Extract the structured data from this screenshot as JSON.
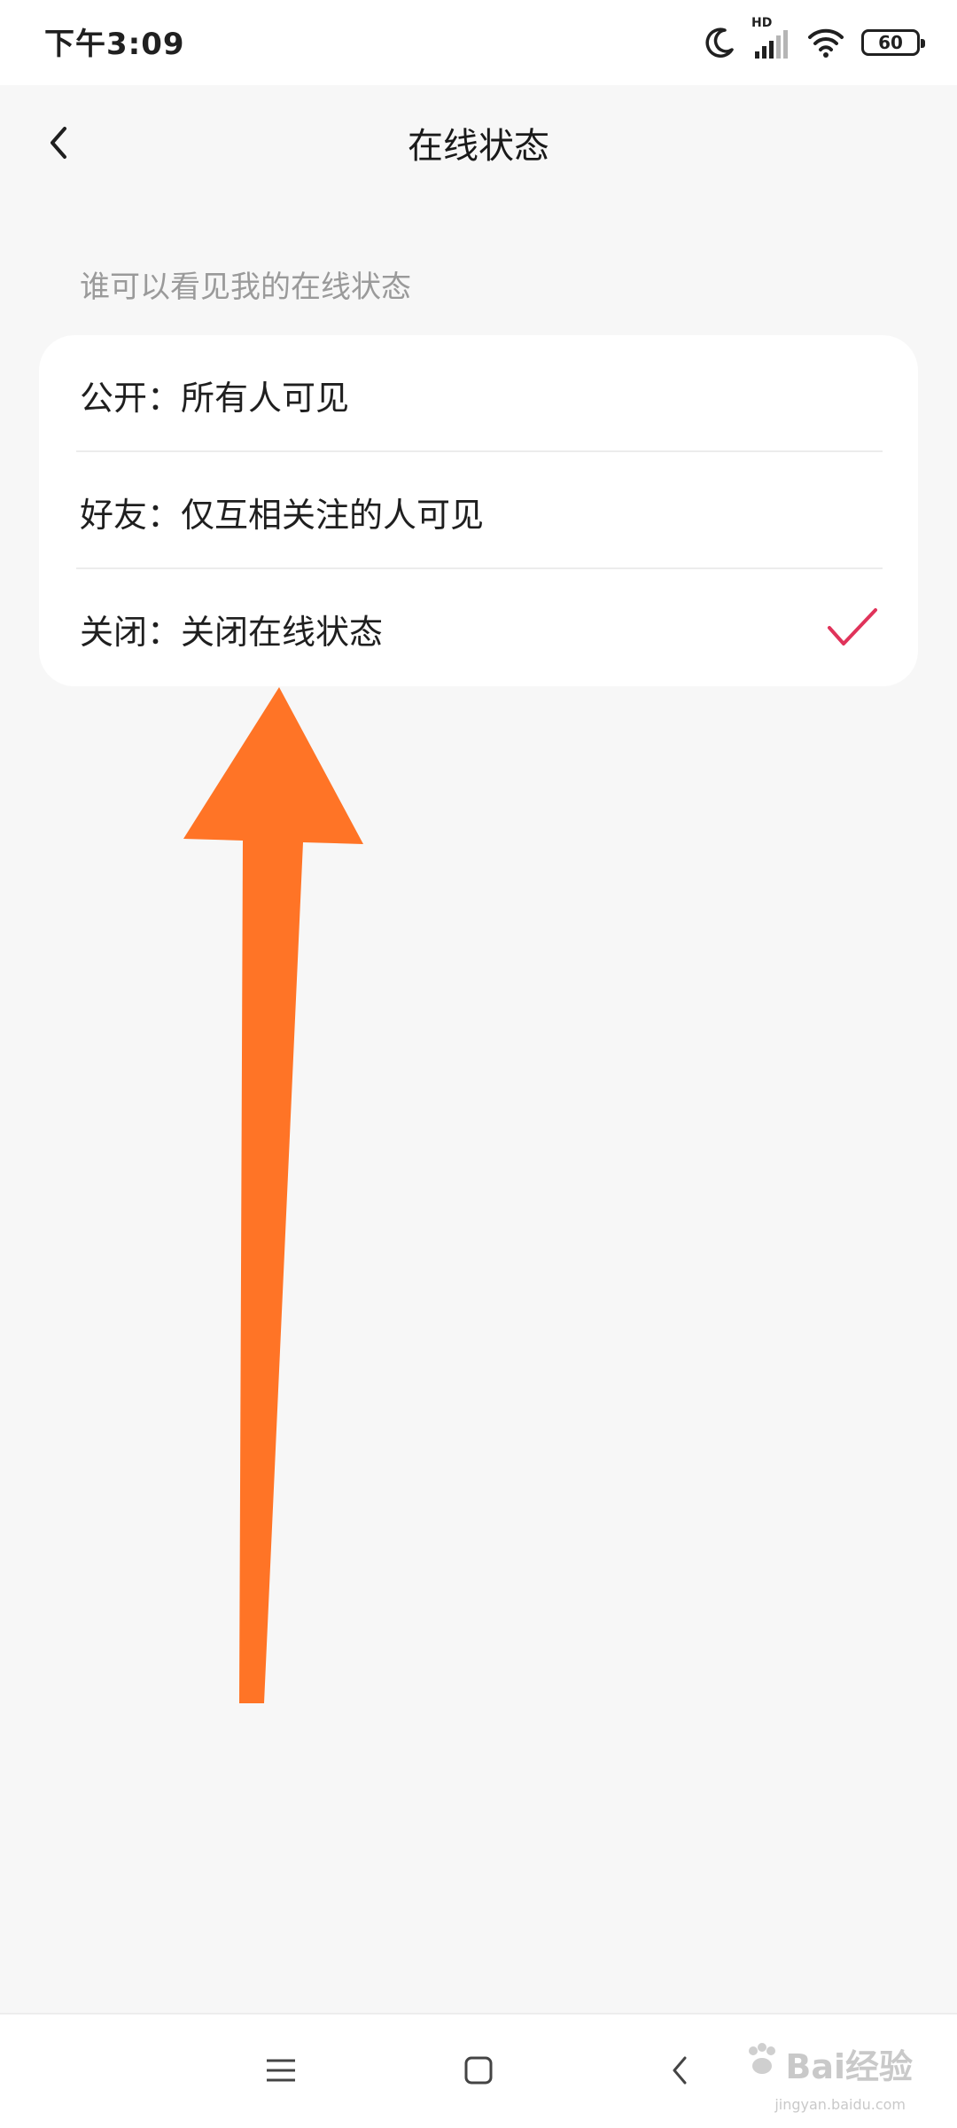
{
  "status_bar": {
    "time": "下午3:09",
    "network_badge": "HD",
    "battery_level": "60",
    "icons": [
      "moon-icon",
      "signal-icon",
      "wifi-icon",
      "battery-icon"
    ]
  },
  "header": {
    "title": "在线状态",
    "back_icon": "chevron-left-icon"
  },
  "section": {
    "label": "谁可以看见我的在线状态"
  },
  "options": [
    {
      "label": "公开：所有人可见",
      "selected": false
    },
    {
      "label": "好友：仅互相关注的人可见",
      "selected": false
    },
    {
      "label": "关闭：关闭在线状态",
      "selected": true
    }
  ],
  "colors": {
    "check": "#e0335a",
    "annotation_arrow": "#ff7426",
    "background": "#f7f7f7"
  },
  "nav_bar": {
    "icons": [
      "menu-icon",
      "home-square-icon",
      "back-triangle-icon"
    ]
  },
  "watermark": {
    "text": "Bai经验",
    "subtext": "jingyan.baidu.com"
  }
}
